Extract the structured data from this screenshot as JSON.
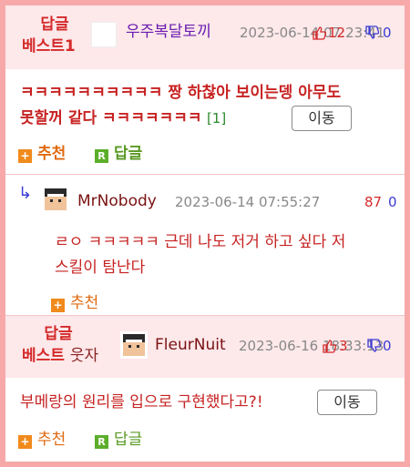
{
  "comments": [
    {
      "badge_line1": "답글",
      "badge_line2": "베스트1",
      "nick": "우주복달토끼",
      "date": "2023-06-14 07:23:41",
      "vote_up": "12",
      "vote_down": "0",
      "text_line1": "ㅋㅋㅋㅋㅋㅋㅋㅋㅋㅋ 짱 하찮아 보이는뎅 아무도",
      "text_line2": "못할꺼 같다 ㅋㅋㅋㅋㅋㅋㅋ",
      "reply_count": "[1]",
      "move_label": "이동",
      "recommend_label": "추천",
      "reply_label": "답글"
    },
    {
      "nick": "MrNobody",
      "date": "2023-06-14 07:55:27",
      "vote_up": "87",
      "vote_down": "0",
      "text_line1": "ㄹㅇ ㅋㅋㅋㅋㅋ 근데 나도 저거 하고 싶다 저",
      "text_line2": "스킬이 탐난다",
      "recommend_label": "추천"
    },
    {
      "badge_line1": "답글",
      "badge_line2": "베스트",
      "badge_line2_sub": "웃자",
      "nick": "FleurNuit",
      "date": "2023-06-16 18:33:13",
      "vote_up": "3",
      "vote_down": "0",
      "text_line1": "부메랑의 원리를 입으로 구현했다고?!",
      "move_label": "이동",
      "recommend_label": "추천",
      "reply_label": "답글"
    }
  ],
  "colors": {
    "frame": "#f7a9aa",
    "best_bg": "#fde8ea",
    "accent_red": "#d42a2a",
    "vote_down_blue": "#3b3bd4",
    "recommend_orange": "#e06a10",
    "reply_green": "#5a9a24"
  }
}
